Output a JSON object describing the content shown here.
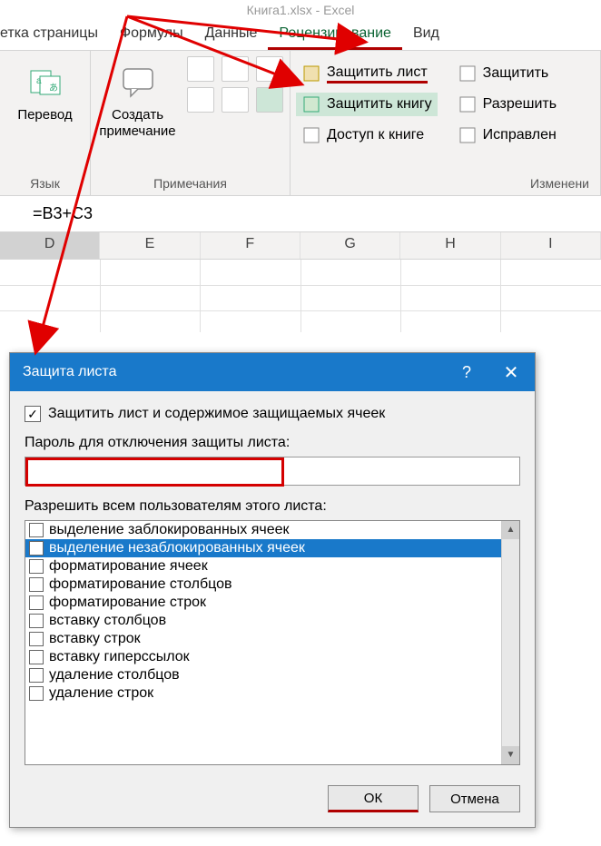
{
  "app": {
    "title": "Книга1.xlsx - Excel"
  },
  "tabs": {
    "page_layout": "етка страницы",
    "formulas": "Формулы",
    "data": "Данные",
    "review": "Рецензирование",
    "view": "Вид"
  },
  "ribbon": {
    "translate": {
      "label": "Перевод",
      "group": "Язык"
    },
    "new_comment": {
      "label": "Создать\nпримечание",
      "group": "Примечания"
    },
    "protect_sheet": "Защитить лист",
    "protect_workbook": "Защитить книгу",
    "share_workbook": "Доступ к книге",
    "protect": "Защитить",
    "allow_edit": "Разрешить",
    "track_changes": "Исправлен",
    "group_changes": "Изменени",
    "group_comments": "Примечания",
    "group_language": "Язык"
  },
  "formula_bar": {
    "value": "=B3+C3"
  },
  "columns": [
    "D",
    "E",
    "F",
    "G",
    "H",
    "I"
  ],
  "dialog": {
    "title": "Защита листа",
    "protect_checkbox": "Защитить лист и содержимое защищаемых ячеек",
    "password_label": "Пароль для отключения защиты листа:",
    "permissions_label": "Разрешить всем пользователям этого листа:",
    "permissions": [
      "выделение заблокированных ячеек",
      "выделение незаблокированных ячеек",
      "форматирование ячеек",
      "форматирование столбцов",
      "форматирование строк",
      "вставку столбцов",
      "вставку строк",
      "вставку гиперссылок",
      "удаление столбцов",
      "удаление строк"
    ],
    "ok": "ОК",
    "cancel": "Отмена"
  }
}
